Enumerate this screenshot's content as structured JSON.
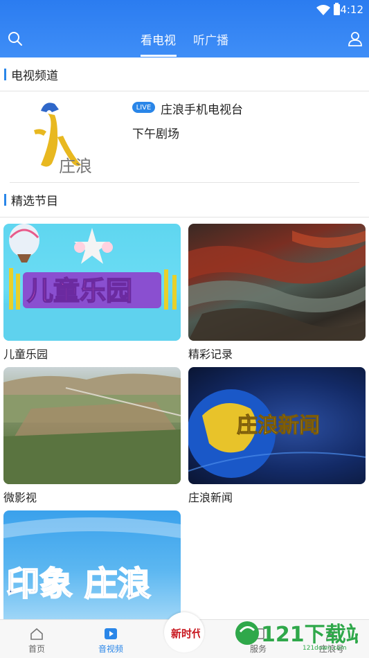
{
  "status_bar": {
    "time": "4:12"
  },
  "nav": {
    "tabs": [
      {
        "label": "看电视",
        "active": true
      },
      {
        "label": "听广播",
        "active": false
      }
    ],
    "icons": {
      "search": "search-icon",
      "user": "user-icon"
    }
  },
  "sections": {
    "tv_channels": "电视频道",
    "featured": "精选节目"
  },
  "channel": {
    "live_badge": "LIVE",
    "name": "庄浪手机电视台",
    "current_program": "下午剧场",
    "logo_text": "庄浪"
  },
  "programs": [
    {
      "title": "儿童乐园",
      "art_text": "儿童乐园"
    },
    {
      "title": "精彩记录"
    },
    {
      "title": "微影视"
    },
    {
      "title": "庄浪新闻",
      "art_text": "庄浪新闻"
    },
    {
      "title": "",
      "art_text": "印象 庄浪"
    }
  ],
  "bottom_nav": {
    "items": [
      {
        "label": "首页",
        "icon": "home-icon",
        "active": false
      },
      {
        "label": "音视频",
        "icon": "play-icon",
        "active": true
      },
      {
        "label": "服务",
        "icon": "service-icon",
        "active": false
      },
      {
        "label": "庄浪号",
        "icon": "account-icon",
        "active": false
      }
    ],
    "center_logo_text": "新时代"
  },
  "watermark": {
    "brand": "121下载站",
    "url": "121down.com"
  },
  "colors": {
    "accent": "#2a86e8",
    "header": "#3a8af5"
  }
}
